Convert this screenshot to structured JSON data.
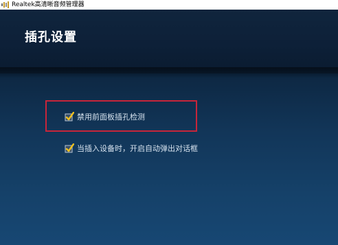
{
  "window": {
    "title": "Realtek高清晰音频管理器",
    "icon": "speaker-icon"
  },
  "header": {
    "title": "插孔设置"
  },
  "options": [
    {
      "label": "禁用前面板插孔检测",
      "checked": true,
      "highlighted": true
    },
    {
      "label": "当插入设备时，开启自动弹出对话框",
      "checked": true,
      "highlighted": false
    }
  ],
  "colors": {
    "highlight_border": "#c8253a",
    "checkmark": "#f0c020",
    "background_top": "#0d2742",
    "background_bottom": "#174773"
  }
}
